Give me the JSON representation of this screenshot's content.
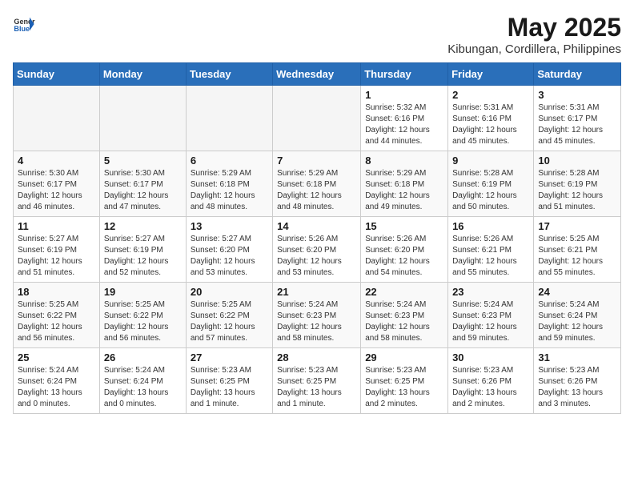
{
  "header": {
    "logo_general": "General",
    "logo_blue": "Blue",
    "month": "May 2025",
    "location": "Kibungan, Cordillera, Philippines"
  },
  "weekdays": [
    "Sunday",
    "Monday",
    "Tuesday",
    "Wednesday",
    "Thursday",
    "Friday",
    "Saturday"
  ],
  "weeks": [
    [
      {
        "day": "",
        "info": ""
      },
      {
        "day": "",
        "info": ""
      },
      {
        "day": "",
        "info": ""
      },
      {
        "day": "",
        "info": ""
      },
      {
        "day": "1",
        "info": "Sunrise: 5:32 AM\nSunset: 6:16 PM\nDaylight: 12 hours\nand 44 minutes."
      },
      {
        "day": "2",
        "info": "Sunrise: 5:31 AM\nSunset: 6:16 PM\nDaylight: 12 hours\nand 45 minutes."
      },
      {
        "day": "3",
        "info": "Sunrise: 5:31 AM\nSunset: 6:17 PM\nDaylight: 12 hours\nand 45 minutes."
      }
    ],
    [
      {
        "day": "4",
        "info": "Sunrise: 5:30 AM\nSunset: 6:17 PM\nDaylight: 12 hours\nand 46 minutes."
      },
      {
        "day": "5",
        "info": "Sunrise: 5:30 AM\nSunset: 6:17 PM\nDaylight: 12 hours\nand 47 minutes."
      },
      {
        "day": "6",
        "info": "Sunrise: 5:29 AM\nSunset: 6:18 PM\nDaylight: 12 hours\nand 48 minutes."
      },
      {
        "day": "7",
        "info": "Sunrise: 5:29 AM\nSunset: 6:18 PM\nDaylight: 12 hours\nand 48 minutes."
      },
      {
        "day": "8",
        "info": "Sunrise: 5:29 AM\nSunset: 6:18 PM\nDaylight: 12 hours\nand 49 minutes."
      },
      {
        "day": "9",
        "info": "Sunrise: 5:28 AM\nSunset: 6:19 PM\nDaylight: 12 hours\nand 50 minutes."
      },
      {
        "day": "10",
        "info": "Sunrise: 5:28 AM\nSunset: 6:19 PM\nDaylight: 12 hours\nand 51 minutes."
      }
    ],
    [
      {
        "day": "11",
        "info": "Sunrise: 5:27 AM\nSunset: 6:19 PM\nDaylight: 12 hours\nand 51 minutes."
      },
      {
        "day": "12",
        "info": "Sunrise: 5:27 AM\nSunset: 6:19 PM\nDaylight: 12 hours\nand 52 minutes."
      },
      {
        "day": "13",
        "info": "Sunrise: 5:27 AM\nSunset: 6:20 PM\nDaylight: 12 hours\nand 53 minutes."
      },
      {
        "day": "14",
        "info": "Sunrise: 5:26 AM\nSunset: 6:20 PM\nDaylight: 12 hours\nand 53 minutes."
      },
      {
        "day": "15",
        "info": "Sunrise: 5:26 AM\nSunset: 6:20 PM\nDaylight: 12 hours\nand 54 minutes."
      },
      {
        "day": "16",
        "info": "Sunrise: 5:26 AM\nSunset: 6:21 PM\nDaylight: 12 hours\nand 55 minutes."
      },
      {
        "day": "17",
        "info": "Sunrise: 5:25 AM\nSunset: 6:21 PM\nDaylight: 12 hours\nand 55 minutes."
      }
    ],
    [
      {
        "day": "18",
        "info": "Sunrise: 5:25 AM\nSunset: 6:22 PM\nDaylight: 12 hours\nand 56 minutes."
      },
      {
        "day": "19",
        "info": "Sunrise: 5:25 AM\nSunset: 6:22 PM\nDaylight: 12 hours\nand 56 minutes."
      },
      {
        "day": "20",
        "info": "Sunrise: 5:25 AM\nSunset: 6:22 PM\nDaylight: 12 hours\nand 57 minutes."
      },
      {
        "day": "21",
        "info": "Sunrise: 5:24 AM\nSunset: 6:23 PM\nDaylight: 12 hours\nand 58 minutes."
      },
      {
        "day": "22",
        "info": "Sunrise: 5:24 AM\nSunset: 6:23 PM\nDaylight: 12 hours\nand 58 minutes."
      },
      {
        "day": "23",
        "info": "Sunrise: 5:24 AM\nSunset: 6:23 PM\nDaylight: 12 hours\nand 59 minutes."
      },
      {
        "day": "24",
        "info": "Sunrise: 5:24 AM\nSunset: 6:24 PM\nDaylight: 12 hours\nand 59 minutes."
      }
    ],
    [
      {
        "day": "25",
        "info": "Sunrise: 5:24 AM\nSunset: 6:24 PM\nDaylight: 13 hours\nand 0 minutes."
      },
      {
        "day": "26",
        "info": "Sunrise: 5:24 AM\nSunset: 6:24 PM\nDaylight: 13 hours\nand 0 minutes."
      },
      {
        "day": "27",
        "info": "Sunrise: 5:23 AM\nSunset: 6:25 PM\nDaylight: 13 hours\nand 1 minute."
      },
      {
        "day": "28",
        "info": "Sunrise: 5:23 AM\nSunset: 6:25 PM\nDaylight: 13 hours\nand 1 minute."
      },
      {
        "day": "29",
        "info": "Sunrise: 5:23 AM\nSunset: 6:25 PM\nDaylight: 13 hours\nand 2 minutes."
      },
      {
        "day": "30",
        "info": "Sunrise: 5:23 AM\nSunset: 6:26 PM\nDaylight: 13 hours\nand 2 minutes."
      },
      {
        "day": "31",
        "info": "Sunrise: 5:23 AM\nSunset: 6:26 PM\nDaylight: 13 hours\nand 3 minutes."
      }
    ]
  ]
}
